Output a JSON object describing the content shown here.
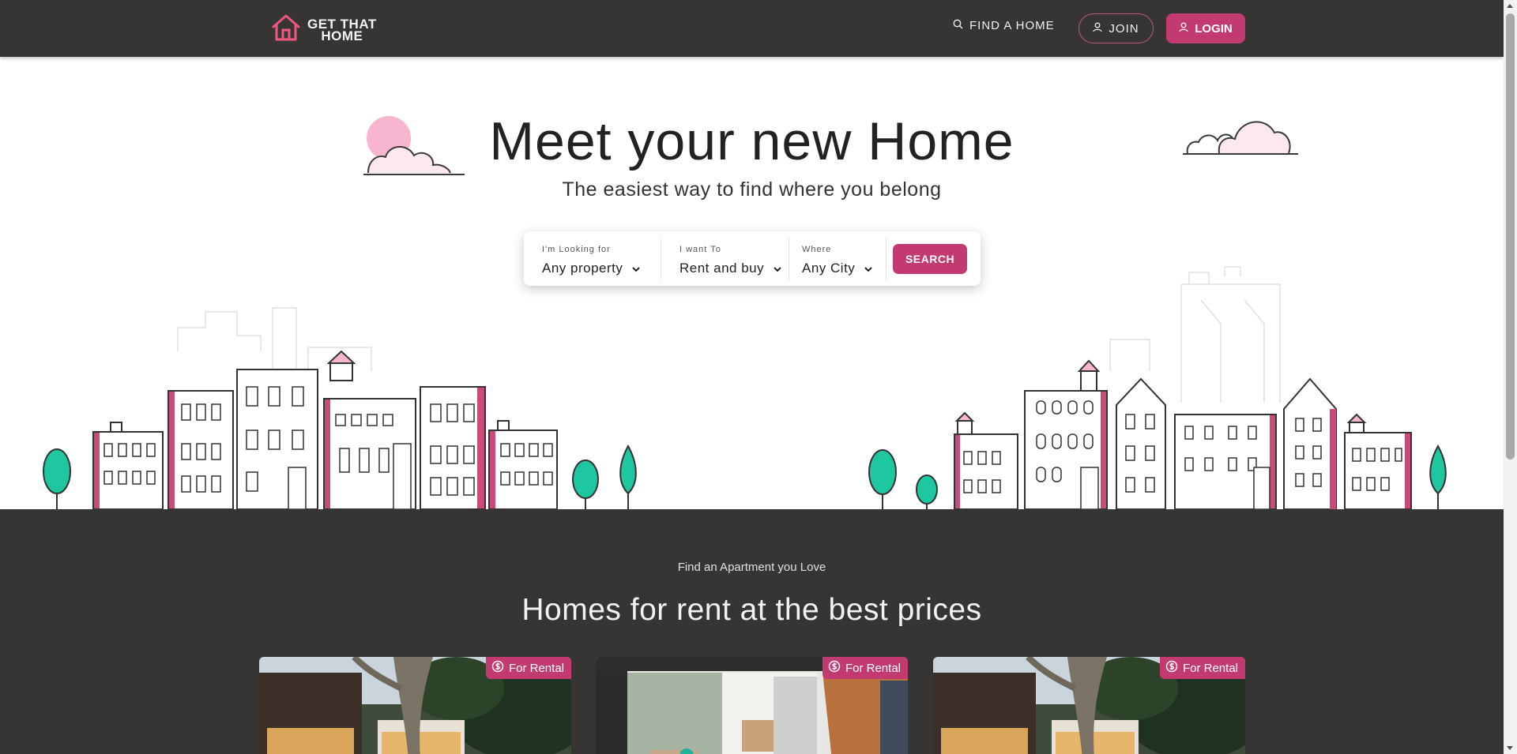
{
  "nav": {
    "logo_line1": "GET THAT",
    "logo_line2": "HOME",
    "find_label": "FIND A HOME",
    "join_label": "JOIN",
    "login_label": "LOGIN"
  },
  "hero": {
    "title": "Meet your new Home",
    "subtitle": "The easiest way to find where you belong"
  },
  "search": {
    "property_label": "I'm Looking for",
    "property_value": "Any property",
    "operation_label": "I want To",
    "operation_value": "Rent and buy",
    "city_label": "Where",
    "city_value": "Any City",
    "button_label": "SEARCH"
  },
  "listings": {
    "eyebrow": "Find an Apartment you Love",
    "title": "Homes for rent at the best prices",
    "cards": [
      {
        "badge": "For Rental"
      },
      {
        "badge": "For Rental"
      },
      {
        "badge": "For Rental"
      }
    ]
  },
  "colors": {
    "nav_bg": "#373534",
    "accent": "#c23a70",
    "tree": "#1fc7a0",
    "pink_light": "#f8c9da"
  }
}
